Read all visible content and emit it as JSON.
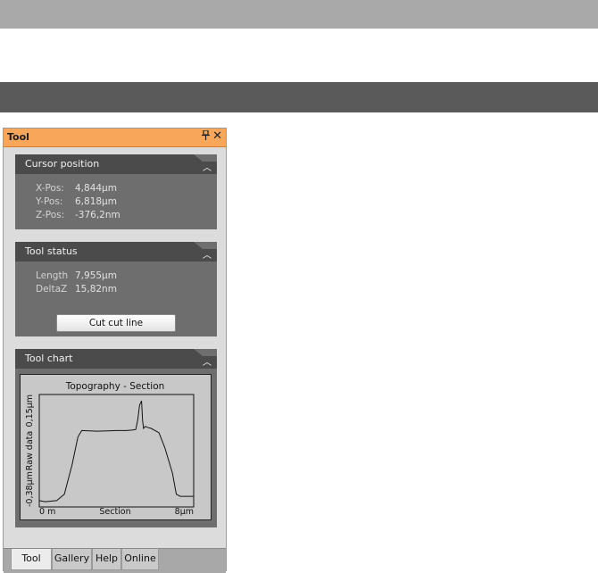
{
  "panel": {
    "title": "Tool",
    "pin_icon": "pin-icon",
    "close_icon": "close-icon"
  },
  "cursor_position": {
    "title": "Cursor position",
    "rows": [
      {
        "label": "X-Pos:",
        "value": "4,844µm"
      },
      {
        "label": "Y-Pos:",
        "value": "6,818µm"
      },
      {
        "label": "Z-Pos:",
        "value": "-376,2nm"
      }
    ]
  },
  "tool_status": {
    "title": "Tool status",
    "rows": [
      {
        "label": "Length",
        "value": "7,955µm"
      },
      {
        "label": "DeltaZ",
        "value": "15,82nm"
      }
    ],
    "button_label": "Cut cut line"
  },
  "tool_chart": {
    "title": "Tool chart"
  },
  "chart_data": {
    "type": "line",
    "title": "Topography - Section",
    "xlabel": "Section",
    "ylabel": "Raw data",
    "x_tick_labels": [
      "0 m",
      "8µm"
    ],
    "y_tick_labels": [
      "-0,38µm",
      "0,15µm"
    ],
    "xlim": [
      0,
      8
    ],
    "ylim": [
      -0.38,
      0.15
    ],
    "series": [
      {
        "x": [
          0,
          0.3,
          0.9,
          1.3,
          1.7,
          2.0,
          2.2,
          3.0,
          4.0,
          4.5,
          4.8,
          5.0,
          5.1,
          5.2,
          5.3,
          5.35,
          5.4,
          5.5,
          5.6,
          5.8,
          6.0,
          6.2,
          6.5,
          6.9,
          7.1,
          7.3,
          8.0
        ],
        "y": [
          -0.35,
          -0.355,
          -0.35,
          -0.32,
          -0.18,
          -0.05,
          -0.02,
          -0.023,
          -0.02,
          -0.02,
          -0.018,
          -0.015,
          0.03,
          0.1,
          0.12,
          0.03,
          -0.01,
          0.0,
          -0.005,
          -0.01,
          -0.02,
          -0.03,
          -0.1,
          -0.22,
          -0.32,
          -0.33,
          -0.33
        ]
      }
    ],
    "grid": false
  },
  "tabs": [
    {
      "label": "Tool",
      "active": true
    },
    {
      "label": "Gallery",
      "active": false
    },
    {
      "label": "Help",
      "active": false
    },
    {
      "label": "Online",
      "active": false
    }
  ]
}
